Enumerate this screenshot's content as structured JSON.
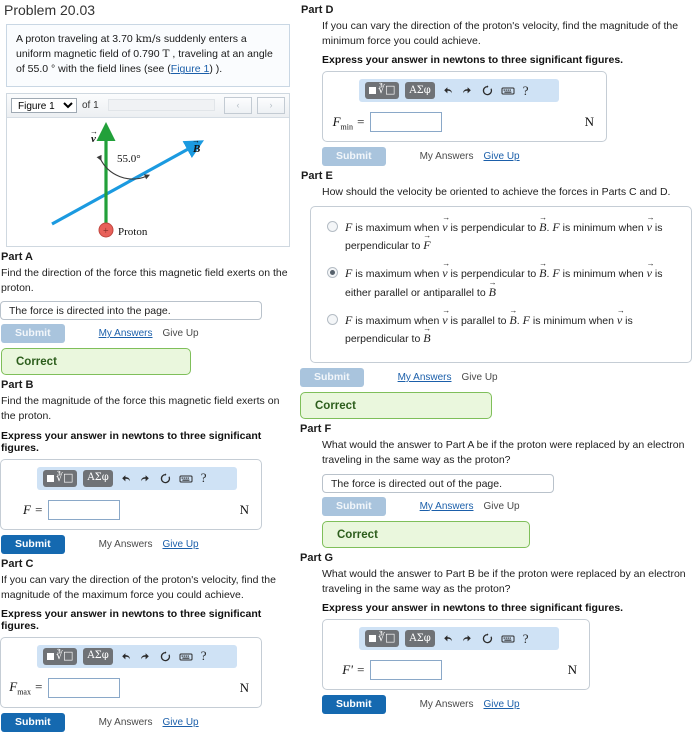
{
  "header": {
    "problem_title": "Problem 20.03"
  },
  "statement": {
    "text_1": "A proton traveling at 3.70 ",
    "unit_speed": "km/s",
    "text_2": " suddenly enters a uniform magnetic field of 0.790 ",
    "unit_field": "T",
    "text_3": " , traveling at an angle of 55.0 ",
    "degree": "°",
    "text_4": " with the field lines (see (",
    "figure_link": "Figure 1",
    "text_5": ") )."
  },
  "figure_bar": {
    "selected_figure": "Figure 1",
    "options": [
      "Figure 1"
    ],
    "of_label": "of 1",
    "prev_label": "‹",
    "next_label": "›"
  },
  "figure": {
    "v_label": "v",
    "b_label": "B",
    "angle_label": "55.0°",
    "proton_label": "Proton",
    "proton_sign": "+",
    "colors": {
      "velocity_vector": "#22a03a",
      "field_vector": "#1b9ae0",
      "proton_fill": "#e8615a",
      "angle_arc": "#3a3a3a"
    }
  },
  "toolbar": {
    "template_sq": "■",
    "template_root": "∛□",
    "greek_label": "ΑΣφ",
    "undo_name": "undo-icon",
    "redo_name": "redo-icon",
    "reset_name": "refresh-icon",
    "keyboard_name": "keyboard-icon",
    "help_label": "?"
  },
  "common": {
    "submit_label": "Submit",
    "my_answers_label": "My Answers",
    "give_up_label": "Give Up",
    "correct_label": "Correct",
    "unit_newton": "N"
  },
  "parts": {
    "a": {
      "heading": "Part A",
      "question": "Find the direction of the force this magnetic field exerts on the proton.",
      "answer_value": "The force is directed into the page.",
      "submit_state": "disabled",
      "feedback": "Correct"
    },
    "b": {
      "heading": "Part B",
      "question": "Find the magnitude of the force this magnetic field exerts on the proton.",
      "instruction": "Express your answer in newtons to three significant figures.",
      "var_label": "F",
      "var_sub": "",
      "input_value": "",
      "unit": "N",
      "submit_state": "active"
    },
    "c": {
      "heading": "Part C",
      "question": "If you can vary the direction of the proton's velocity, find the magnitude of the maximum force you could achieve.",
      "instruction": "Express your answer in newtons to three significant figures.",
      "var_label": "F",
      "var_sub": "max",
      "input_value": "",
      "unit": "N",
      "submit_state": "active"
    },
    "d": {
      "heading": "Part D",
      "question": "If you can vary the direction of the proton's velocity, find the magnitude of the minimum force you could achieve.",
      "instruction": "Express your answer in newtons to three significant figures.",
      "var_label": "F",
      "var_sub": "min",
      "input_value": "",
      "unit": "N",
      "submit_state": "active"
    },
    "e": {
      "heading": "Part E",
      "question": "How should the velocity be oriented to achieve the forces in Parts C and D.",
      "choices": [
        {
          "selected": false,
          "seg": [
            "F",
            " is maximum when ",
            "v",
            " is perpendicular to ",
            "B",
            ". ",
            "F",
            " is minimum when ",
            "v",
            " is perpendicular to ",
            "F"
          ]
        },
        {
          "selected": true,
          "seg": [
            "F",
            " is maximum when ",
            "v",
            " is perpendicular to ",
            "B",
            ". ",
            "F",
            " is minimum when ",
            "v",
            " is either parallel or antiparallel to ",
            "B"
          ]
        },
        {
          "selected": false,
          "seg": [
            "F",
            " is maximum when ",
            "v",
            " is parallel to ",
            "B",
            ". ",
            "F",
            " is minimum when ",
            "v",
            " is perpendicular to ",
            "B"
          ]
        }
      ],
      "submit_state": "disabled",
      "feedback": "Correct"
    },
    "f": {
      "heading": "Part F",
      "question": "What would the answer to Part A be if the proton were replaced by an electron traveling in the same way as the proton?",
      "answer_value": "The force is directed out of the page.",
      "submit_state": "disabled",
      "feedback": "Correct"
    },
    "g": {
      "heading": "Part G",
      "question": "What would the answer to Part B be if the proton were replaced by an electron traveling in the same way as the proton?",
      "instruction": "Express your answer in newtons to three significant figures.",
      "var_label": "F'",
      "var_sub": "",
      "input_value": "",
      "unit": "N",
      "submit_state": "active"
    }
  }
}
